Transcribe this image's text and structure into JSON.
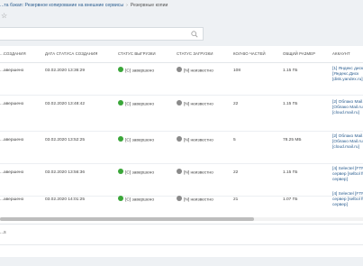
{
  "breadcrumb": {
    "items": [
      "...та бэкап: Резервное копирование на внешние сервисы",
      "Резервные копии"
    ],
    "separator": "›"
  },
  "star_icon": "star-icon",
  "search": {
    "placeholder": ""
  },
  "table": {
    "headers": [
      "...СОЗДАНИЯ",
      "ДАТА СТАТУСА СОЗДАНИЯ",
      "СТАТУС ВЫГРУЗКИ",
      "СТАТУС ЗАГРУЗКИ",
      "КОЛ-ВО ЧАСТЕЙ",
      "ОБЩИЙ РАЗМЕР",
      "АККАУНТ"
    ],
    "rows": [
      {
        "creation_status": "...авершено",
        "date": "03.02.2020 13:36:29",
        "upload_status": "[С] завершено",
        "download_status": "[N] неизвестно",
        "parts": "108",
        "size": "1.15 ГБ",
        "account": "[1] Яндекс диск [Яндекс.Диск [disk.yandex.ru]"
      },
      {
        "creation_status": "...авершено",
        "date": "03.02.2020 13:48:42",
        "upload_status": "[С] завершено",
        "download_status": "[N] неизвестно",
        "parts": "22",
        "size": "1.15 ГБ",
        "account": "[2] Облако Mail.ru [Облако Mail.ru [cloud.mail.ru]"
      },
      {
        "creation_status": "...авершено",
        "date": "03.02.2020 13:52:25",
        "upload_status": "[С] завершено",
        "download_status": "[N] неизвестно",
        "parts": "5",
        "size": "78.25 МБ",
        "account": "[2] Облако Mail.ru [Облако Mail.ru [cloud.mail.ru]"
      },
      {
        "creation_status": "...авершено",
        "date": "03.02.2020 13:56:36",
        "upload_status": "[С] завершено",
        "download_status": "[N] неизвестно",
        "parts": "22",
        "size": "1.15 ГБ",
        "account": "[4] Selectel [FTP сервер [selbol ftp сервер]"
      },
      {
        "creation_status": "...авершено",
        "date": "03.02.2020 14:01:25",
        "upload_status": "[С] завершено",
        "download_status": "[N] неизвестно",
        "parts": "21",
        "size": "1.07 ГБ",
        "account": "[4] Selectel [FTP сервер [selbol ftp сервер]"
      }
    ]
  },
  "footer": {
    "text": "...s"
  },
  "colors": {
    "success": "#3aa639",
    "unknown": "#8a8a8a",
    "link": "#2a5d8f"
  }
}
